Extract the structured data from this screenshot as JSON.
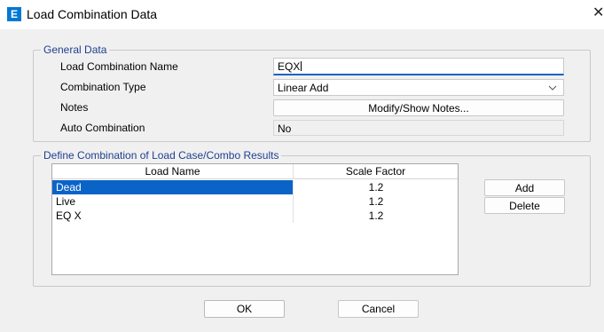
{
  "window": {
    "title": "Load Combination Data",
    "app_icon_letter": "E",
    "close_glyph": "✕"
  },
  "general": {
    "group_title": "General Data",
    "name_label": "Load Combination Name",
    "name_value": "EQX",
    "type_label": "Combination Type",
    "type_value": "Linear Add",
    "notes_label": "Notes",
    "notes_button": "Modify/Show Notes...",
    "auto_label": "Auto Combination",
    "auto_value": "No"
  },
  "define": {
    "group_title": "Define Combination of Load Case/Combo Results",
    "columns": [
      "Load Name",
      "Scale Factor"
    ],
    "rows": [
      {
        "name": "Dead",
        "scale": "1.2",
        "selected": true
      },
      {
        "name": "Live",
        "scale": "1.2",
        "selected": false
      },
      {
        "name": "EQ X",
        "scale": "1.2",
        "selected": false
      }
    ],
    "add_button": "Add",
    "delete_button": "Delete"
  },
  "footer": {
    "ok_button": "OK",
    "cancel_button": "Cancel"
  },
  "colors": {
    "accent": "#0a64c8",
    "group_title": "#1f3f8f",
    "background": "#f0f0f0"
  }
}
